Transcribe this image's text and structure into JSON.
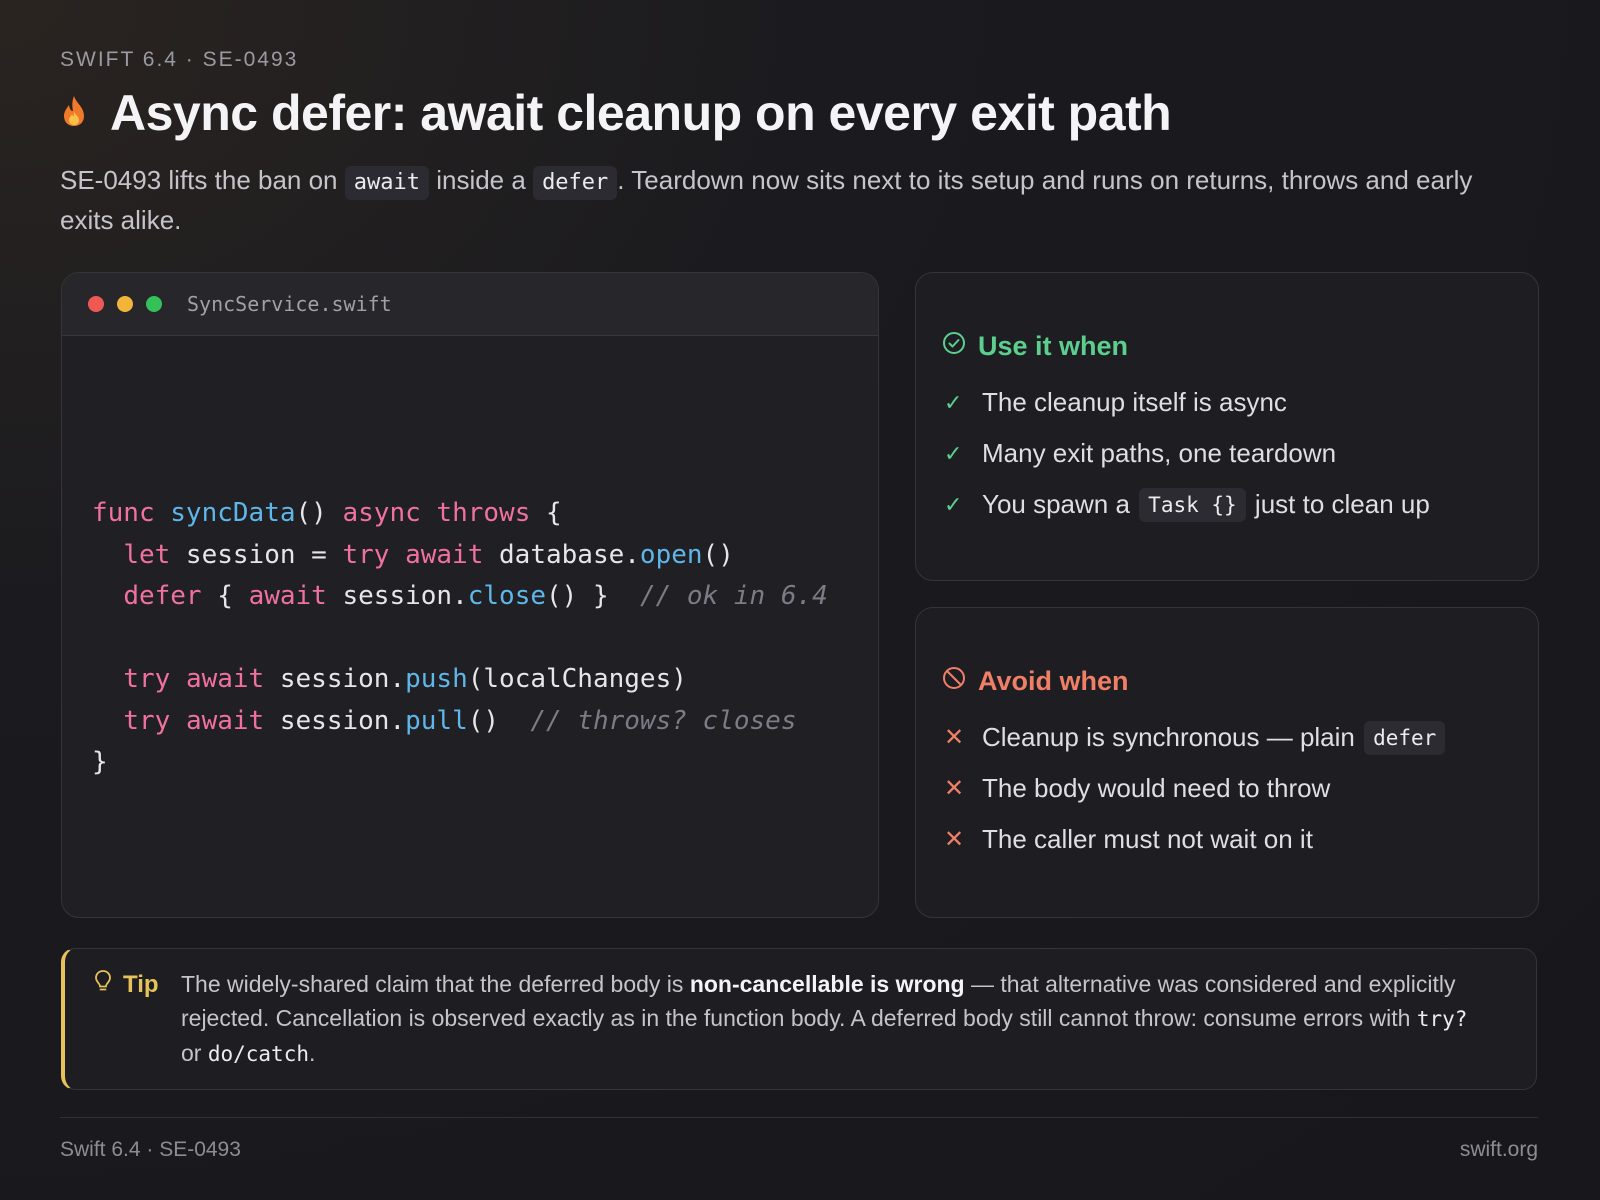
{
  "eyebrow": "SWIFT 6.4 · SE-0493",
  "title": "Async defer: await cleanup on every exit path",
  "subtitle": {
    "part1": "SE-0493 lifts the ban on ",
    "code1": "await",
    "part2": " inside a ",
    "code2": "defer",
    "part3": ". Teardown now sits next to its setup and runs on returns, throws and early exits alike."
  },
  "code_card": {
    "filename": "SyncService.swift",
    "window_dots": [
      "#ee5a52",
      "#f2b53a",
      "#33c25a"
    ],
    "lines": [
      [
        {
          "t": "func",
          "c": "kw"
        },
        {
          "t": " "
        },
        {
          "t": "syncData",
          "c": "fn"
        },
        {
          "t": "() "
        },
        {
          "t": "async",
          "c": "kw"
        },
        {
          "t": " "
        },
        {
          "t": "throws",
          "c": "kw"
        },
        {
          "t": " {"
        }
      ],
      [
        {
          "t": "  "
        },
        {
          "t": "let",
          "c": "kw"
        },
        {
          "t": " session = "
        },
        {
          "t": "try",
          "c": "kw"
        },
        {
          "t": " "
        },
        {
          "t": "await",
          "c": "kw"
        },
        {
          "t": " database."
        },
        {
          "t": "open",
          "c": "fn"
        },
        {
          "t": "()"
        }
      ],
      [
        {
          "t": "  "
        },
        {
          "t": "defer",
          "c": "kw"
        },
        {
          "t": " { "
        },
        {
          "t": "await",
          "c": "kw"
        },
        {
          "t": " session."
        },
        {
          "t": "close",
          "c": "fn"
        },
        {
          "t": "() }  "
        },
        {
          "t": "// ok in 6.4",
          "c": "cm"
        }
      ],
      [
        {
          "t": ""
        }
      ],
      [
        {
          "t": "  "
        },
        {
          "t": "try",
          "c": "kw"
        },
        {
          "t": " "
        },
        {
          "t": "await",
          "c": "kw"
        },
        {
          "t": " session."
        },
        {
          "t": "push",
          "c": "fn"
        },
        {
          "t": "(localChanges)"
        }
      ],
      [
        {
          "t": "  "
        },
        {
          "t": "try",
          "c": "kw"
        },
        {
          "t": " "
        },
        {
          "t": "await",
          "c": "kw"
        },
        {
          "t": " session."
        },
        {
          "t": "pull",
          "c": "fn"
        },
        {
          "t": "()  "
        },
        {
          "t": "// throws? closes",
          "c": "cm"
        }
      ],
      [
        {
          "t": "}"
        }
      ]
    ]
  },
  "use_panel": {
    "heading": "Use it when",
    "items": [
      {
        "text": "The cleanup itself is async"
      },
      {
        "text": "Many exit paths, one teardown"
      },
      {
        "text": "You spawn a ",
        "code": "Task {}",
        "after": " just to clean up"
      }
    ]
  },
  "avoid_panel": {
    "heading": "Avoid when",
    "items": [
      {
        "text": "Cleanup is synchronous — plain ",
        "code": "defer"
      },
      {
        "text": "The body would need to throw"
      },
      {
        "text": "The caller must not wait on it"
      }
    ]
  },
  "tip": {
    "label": "Tip",
    "part1": "The widely-shared claim that the deferred body is ",
    "bold": "non-cancellable is wrong",
    "part2": " — that alternative was considered and explicitly rejected. Cancellation is observed exactly as in the function body. A deferred body still cannot throw: consume errors with ",
    "code1": "try?",
    "part3": " or ",
    "code2": "do/catch",
    "part4": "."
  },
  "footer": {
    "left": "Swift 6.4 · SE-0493",
    "right": "swift.org"
  },
  "colors": {
    "accent_green": "#5ccf8e",
    "accent_red": "#ef7f66",
    "accent_yellow": "#e7c15a",
    "keyword": "#f0729c",
    "function": "#5fb6e8"
  }
}
